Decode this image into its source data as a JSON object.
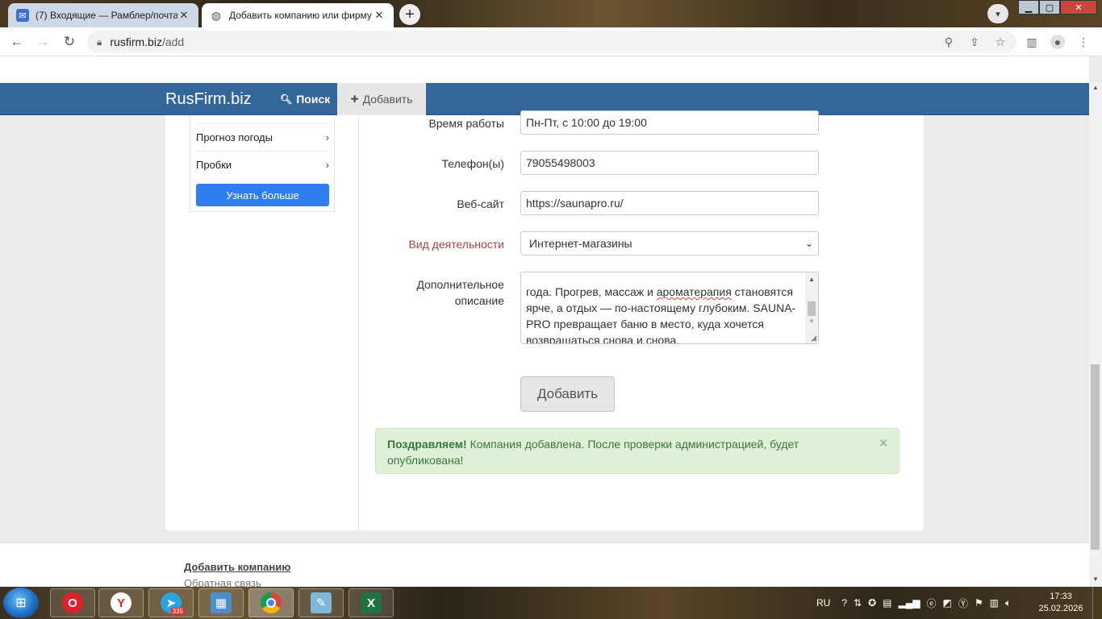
{
  "tabs": [
    {
      "title": "(7) Входящие — Рамблер/почта",
      "close": "✕"
    },
    {
      "title": "Добавить компанию или фирму",
      "close": "✕"
    }
  ],
  "address": {
    "domain": "rusfirm.biz",
    "path": "/add"
  },
  "site": {
    "brand": "RusFirm.biz",
    "nav_search": "Поиск",
    "nav_add": "Добавить"
  },
  "sidebar": {
    "items": [
      {
        "label": "Прогноз погоды"
      },
      {
        "label": "Пробки"
      }
    ],
    "more_button": "Узнать больше"
  },
  "form": {
    "hours": {
      "label": "Время работы",
      "value": "Пн-Пт, с 10:00 до 19:00"
    },
    "phone": {
      "label": "Телефон(ы)",
      "value": "79055498003"
    },
    "website": {
      "label": "Веб-сайт",
      "value": "https://saunapro.ru/"
    },
    "activity": {
      "label": "Вид деятельности",
      "value": "Интернет-магазины"
    },
    "description": {
      "label_line1": "Дополнительное",
      "label_line2": "описание",
      "line1": "года. Прогрев, массаж и ",
      "line1_misspelled": "ароматерапия",
      "line1_end": " становятся",
      "line2": "ярче, а отдых — по-настоящему глубоким. SAUNA-",
      "line3": "PRO превращает баню в место, куда хочется",
      "line4": "возвращаться снова и снова."
    },
    "submit": "Добавить"
  },
  "alert": {
    "strong": "Поздравляем!",
    "text": " Компания добавлена. После проверки администрацией, будет опубликована!",
    "close": "×"
  },
  "footer": {
    "add_company": "Добавить компанию",
    "feedback": "Обратная связь"
  },
  "taskbar": {
    "telegram_badge": "335",
    "lang": "RU",
    "time": "17:33",
    "date": "25.02.2026"
  }
}
